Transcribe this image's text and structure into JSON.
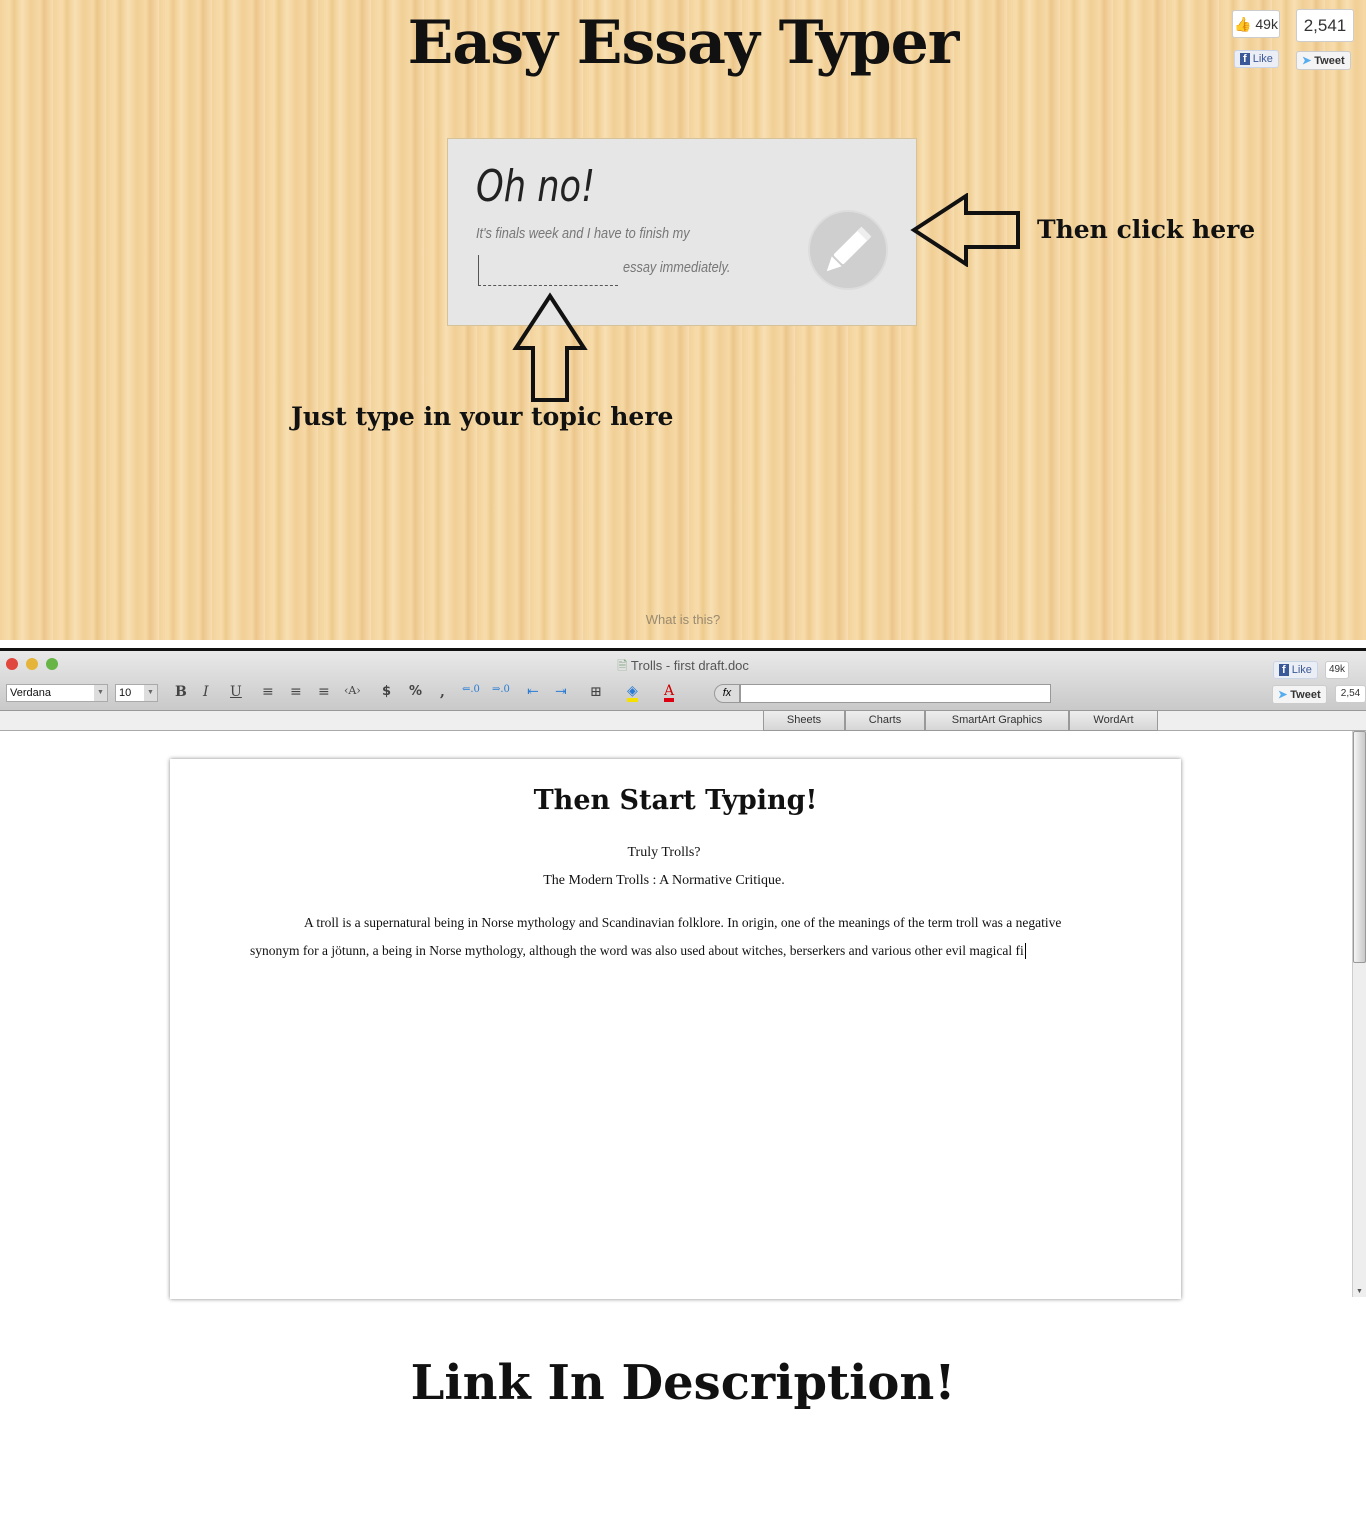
{
  "header": {
    "title": "Easy Essay Typer"
  },
  "share_top": {
    "like_count": "49k",
    "like_label": "Like",
    "tweet_count": "2,541",
    "tweet_label": "Tweet"
  },
  "card": {
    "heading": "Oh no!",
    "line1": "It's finals week and I have to finish my",
    "topic_placeholder": "",
    "line2": "essay immediately.",
    "submit_icon": "pencil-icon"
  },
  "callouts": {
    "click": "Then click here",
    "type": "Just type in your topic here"
  },
  "footer_link": "What is this?",
  "word_app": {
    "doc_title": "Trolls - first draft.doc",
    "font": "Verdana",
    "size": "10",
    "toolbar": {
      "bold": "B",
      "italic": "I",
      "underline": "U",
      "currency": "$",
      "percent": "%",
      "comma": ",",
      "fx": "fx"
    },
    "share": {
      "like_label": "Like",
      "like_count": "49k",
      "tweet_label": "Tweet",
      "tweet_count": "2,54"
    },
    "tabs": [
      "Sheets",
      "Charts",
      "SmartArt Graphics",
      "WordArt"
    ],
    "document": {
      "heading": "Then Start Typing!",
      "title": "Truly Trolls?",
      "subtitle": "The Modern Trolls : A Normative Critique.",
      "line1": "A troll is a supernatural being in Norse mythology and Scandinavian folklore. In origin, one of the meanings of the term troll was a negative",
      "line2": "synonym for a jötunn, a being in Norse mythology, although the word was also used about witches, berserkers and various other evil magical fi"
    }
  },
  "bottom": {
    "title": "Link In Description!"
  },
  "colors": {
    "wood": "#f3d39c",
    "card": "#e6e6e6",
    "facebook": "#3b5998",
    "twitter": "#55acee"
  }
}
